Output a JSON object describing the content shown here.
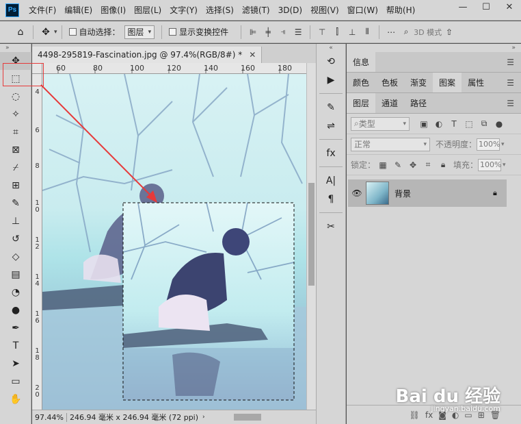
{
  "app": {
    "logo": "Ps"
  },
  "menu": [
    "文件(F)",
    "编辑(E)",
    "图像(I)",
    "图层(L)",
    "文字(Y)",
    "选择(S)",
    "滤镜(T)",
    "3D(D)",
    "视图(V)",
    "窗口(W)",
    "帮助(H)"
  ],
  "window_controls": {
    "minimize": "—",
    "maximize": "☐",
    "close": "✕"
  },
  "options": {
    "auto_select_label": "自动选择：",
    "auto_select_value": "图层",
    "show_transform_label": "显示变换控件",
    "mode_3d_label": "3D 模式"
  },
  "document": {
    "tab_title": "4498-295819-Fascination.jpg @ 97.4%(RGB/8#) *",
    "ruler_top": [
      "60",
      "80",
      "100",
      "120",
      "140",
      "160",
      "180"
    ],
    "ruler_left": [
      "4",
      "6",
      "8",
      "1 0",
      "1 2",
      "1 4",
      "1 6",
      "1 8",
      "2 0"
    ],
    "zoom": "97.44%",
    "dimensions": "246.94 毫米 x 246.94 毫米 (72 ppi)"
  },
  "panels": {
    "info_tab": "信息",
    "color_tabs": [
      "颜色",
      "色板",
      "渐变",
      "图案",
      "属性"
    ],
    "layer_tabs": [
      "图层",
      "通道",
      "路径"
    ],
    "filter_kind": "类型",
    "blend_mode": "正常",
    "opacity_label": "不透明度：",
    "opacity_value": "100%",
    "lock_label": "锁定：",
    "fill_label": "填充：",
    "fill_value": "100%",
    "layer_name": "背景"
  },
  "watermark": {
    "text": "Bai du 经验",
    "url": "jingyan.baidu.com"
  },
  "colors": {
    "highlight": "#e63a3a",
    "panel_bg": "#d6d6d6"
  }
}
